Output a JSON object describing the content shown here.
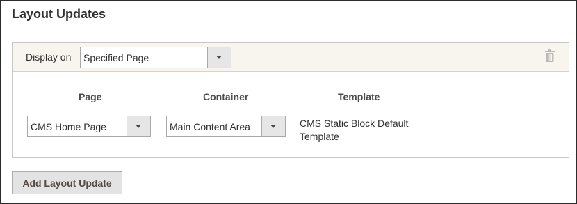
{
  "section": {
    "title": "Layout Updates"
  },
  "update": {
    "display_on_label": "Display on",
    "display_on_value": "Specified Page",
    "columns": {
      "page": "Page",
      "container": "Container",
      "template": "Template"
    },
    "page_value": "CMS Home Page",
    "container_value": "Main Content Area",
    "template_value": "CMS Static Block Default Template",
    "delete_icon": "trash-icon"
  },
  "actions": {
    "add_label": "Add Layout Update"
  },
  "colors": {
    "header_bg": "#f8f5ef",
    "button_bg": "#e3e3e3",
    "select_arrow_bg": "#e6e6e6",
    "text": "#303030"
  }
}
